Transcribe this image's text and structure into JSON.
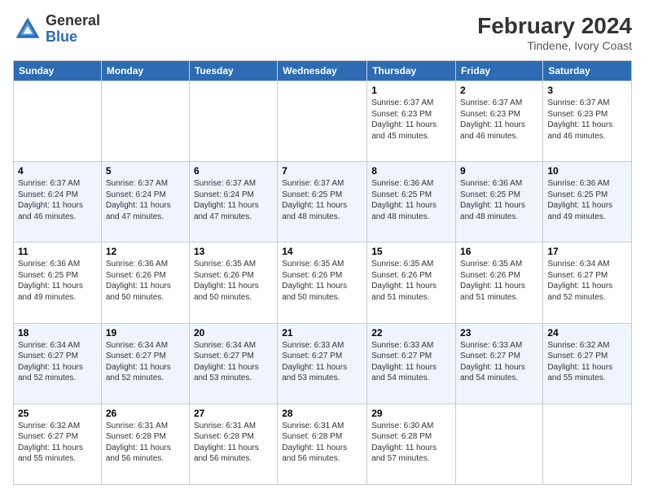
{
  "header": {
    "logo_general": "General",
    "logo_blue": "Blue",
    "month_year": "February 2024",
    "location": "Tindene, Ivory Coast"
  },
  "days_of_week": [
    "Sunday",
    "Monday",
    "Tuesday",
    "Wednesday",
    "Thursday",
    "Friday",
    "Saturday"
  ],
  "weeks": [
    [
      {
        "day": "",
        "info": ""
      },
      {
        "day": "",
        "info": ""
      },
      {
        "day": "",
        "info": ""
      },
      {
        "day": "",
        "info": ""
      },
      {
        "day": "1",
        "info": "Sunrise: 6:37 AM\nSunset: 6:23 PM\nDaylight: 11 hours\nand 45 minutes."
      },
      {
        "day": "2",
        "info": "Sunrise: 6:37 AM\nSunset: 6:23 PM\nDaylight: 11 hours\nand 46 minutes."
      },
      {
        "day": "3",
        "info": "Sunrise: 6:37 AM\nSunset: 6:23 PM\nDaylight: 11 hours\nand 46 minutes."
      }
    ],
    [
      {
        "day": "4",
        "info": "Sunrise: 6:37 AM\nSunset: 6:24 PM\nDaylight: 11 hours\nand 46 minutes."
      },
      {
        "day": "5",
        "info": "Sunrise: 6:37 AM\nSunset: 6:24 PM\nDaylight: 11 hours\nand 47 minutes."
      },
      {
        "day": "6",
        "info": "Sunrise: 6:37 AM\nSunset: 6:24 PM\nDaylight: 11 hours\nand 47 minutes."
      },
      {
        "day": "7",
        "info": "Sunrise: 6:37 AM\nSunset: 6:25 PM\nDaylight: 11 hours\nand 48 minutes."
      },
      {
        "day": "8",
        "info": "Sunrise: 6:36 AM\nSunset: 6:25 PM\nDaylight: 11 hours\nand 48 minutes."
      },
      {
        "day": "9",
        "info": "Sunrise: 6:36 AM\nSunset: 6:25 PM\nDaylight: 11 hours\nand 48 minutes."
      },
      {
        "day": "10",
        "info": "Sunrise: 6:36 AM\nSunset: 6:25 PM\nDaylight: 11 hours\nand 49 minutes."
      }
    ],
    [
      {
        "day": "11",
        "info": "Sunrise: 6:36 AM\nSunset: 6:25 PM\nDaylight: 11 hours\nand 49 minutes."
      },
      {
        "day": "12",
        "info": "Sunrise: 6:36 AM\nSunset: 6:26 PM\nDaylight: 11 hours\nand 50 minutes."
      },
      {
        "day": "13",
        "info": "Sunrise: 6:35 AM\nSunset: 6:26 PM\nDaylight: 11 hours\nand 50 minutes."
      },
      {
        "day": "14",
        "info": "Sunrise: 6:35 AM\nSunset: 6:26 PM\nDaylight: 11 hours\nand 50 minutes."
      },
      {
        "day": "15",
        "info": "Sunrise: 6:35 AM\nSunset: 6:26 PM\nDaylight: 11 hours\nand 51 minutes."
      },
      {
        "day": "16",
        "info": "Sunrise: 6:35 AM\nSunset: 6:26 PM\nDaylight: 11 hours\nand 51 minutes."
      },
      {
        "day": "17",
        "info": "Sunrise: 6:34 AM\nSunset: 6:27 PM\nDaylight: 11 hours\nand 52 minutes."
      }
    ],
    [
      {
        "day": "18",
        "info": "Sunrise: 6:34 AM\nSunset: 6:27 PM\nDaylight: 11 hours\nand 52 minutes."
      },
      {
        "day": "19",
        "info": "Sunrise: 6:34 AM\nSunset: 6:27 PM\nDaylight: 11 hours\nand 52 minutes."
      },
      {
        "day": "20",
        "info": "Sunrise: 6:34 AM\nSunset: 6:27 PM\nDaylight: 11 hours\nand 53 minutes."
      },
      {
        "day": "21",
        "info": "Sunrise: 6:33 AM\nSunset: 6:27 PM\nDaylight: 11 hours\nand 53 minutes."
      },
      {
        "day": "22",
        "info": "Sunrise: 6:33 AM\nSunset: 6:27 PM\nDaylight: 11 hours\nand 54 minutes."
      },
      {
        "day": "23",
        "info": "Sunrise: 6:33 AM\nSunset: 6:27 PM\nDaylight: 11 hours\nand 54 minutes."
      },
      {
        "day": "24",
        "info": "Sunrise: 6:32 AM\nSunset: 6:27 PM\nDaylight: 11 hours\nand 55 minutes."
      }
    ],
    [
      {
        "day": "25",
        "info": "Sunrise: 6:32 AM\nSunset: 6:27 PM\nDaylight: 11 hours\nand 55 minutes."
      },
      {
        "day": "26",
        "info": "Sunrise: 6:31 AM\nSunset: 6:28 PM\nDaylight: 11 hours\nand 56 minutes."
      },
      {
        "day": "27",
        "info": "Sunrise: 6:31 AM\nSunset: 6:28 PM\nDaylight: 11 hours\nand 56 minutes."
      },
      {
        "day": "28",
        "info": "Sunrise: 6:31 AM\nSunset: 6:28 PM\nDaylight: 11 hours\nand 56 minutes."
      },
      {
        "day": "29",
        "info": "Sunrise: 6:30 AM\nSunset: 6:28 PM\nDaylight: 11 hours\nand 57 minutes."
      },
      {
        "day": "",
        "info": ""
      },
      {
        "day": "",
        "info": ""
      }
    ]
  ]
}
